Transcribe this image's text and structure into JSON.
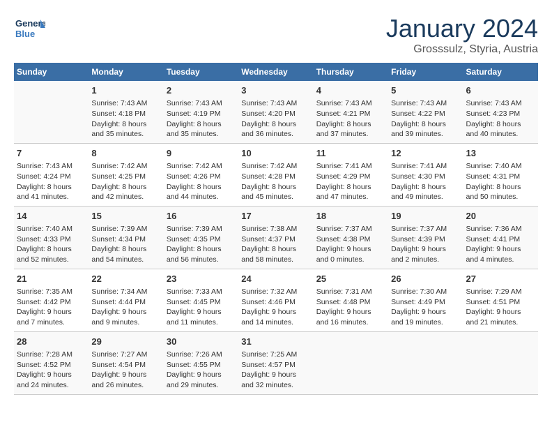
{
  "header": {
    "logo_general": "General",
    "logo_blue": "Blue",
    "month_year": "January 2024",
    "location": "Grosssulz, Styria, Austria"
  },
  "weekdays": [
    "Sunday",
    "Monday",
    "Tuesday",
    "Wednesday",
    "Thursday",
    "Friday",
    "Saturday"
  ],
  "weeks": [
    [
      {
        "day": "",
        "info": ""
      },
      {
        "day": "1",
        "info": "Sunrise: 7:43 AM\nSunset: 4:18 PM\nDaylight: 8 hours\nand 35 minutes."
      },
      {
        "day": "2",
        "info": "Sunrise: 7:43 AM\nSunset: 4:19 PM\nDaylight: 8 hours\nand 35 minutes."
      },
      {
        "day": "3",
        "info": "Sunrise: 7:43 AM\nSunset: 4:20 PM\nDaylight: 8 hours\nand 36 minutes."
      },
      {
        "day": "4",
        "info": "Sunrise: 7:43 AM\nSunset: 4:21 PM\nDaylight: 8 hours\nand 37 minutes."
      },
      {
        "day": "5",
        "info": "Sunrise: 7:43 AM\nSunset: 4:22 PM\nDaylight: 8 hours\nand 39 minutes."
      },
      {
        "day": "6",
        "info": "Sunrise: 7:43 AM\nSunset: 4:23 PM\nDaylight: 8 hours\nand 40 minutes."
      }
    ],
    [
      {
        "day": "7",
        "info": "Sunrise: 7:43 AM\nSunset: 4:24 PM\nDaylight: 8 hours\nand 41 minutes."
      },
      {
        "day": "8",
        "info": "Sunrise: 7:42 AM\nSunset: 4:25 PM\nDaylight: 8 hours\nand 42 minutes."
      },
      {
        "day": "9",
        "info": "Sunrise: 7:42 AM\nSunset: 4:26 PM\nDaylight: 8 hours\nand 44 minutes."
      },
      {
        "day": "10",
        "info": "Sunrise: 7:42 AM\nSunset: 4:28 PM\nDaylight: 8 hours\nand 45 minutes."
      },
      {
        "day": "11",
        "info": "Sunrise: 7:41 AM\nSunset: 4:29 PM\nDaylight: 8 hours\nand 47 minutes."
      },
      {
        "day": "12",
        "info": "Sunrise: 7:41 AM\nSunset: 4:30 PM\nDaylight: 8 hours\nand 49 minutes."
      },
      {
        "day": "13",
        "info": "Sunrise: 7:40 AM\nSunset: 4:31 PM\nDaylight: 8 hours\nand 50 minutes."
      }
    ],
    [
      {
        "day": "14",
        "info": "Sunrise: 7:40 AM\nSunset: 4:33 PM\nDaylight: 8 hours\nand 52 minutes."
      },
      {
        "day": "15",
        "info": "Sunrise: 7:39 AM\nSunset: 4:34 PM\nDaylight: 8 hours\nand 54 minutes."
      },
      {
        "day": "16",
        "info": "Sunrise: 7:39 AM\nSunset: 4:35 PM\nDaylight: 8 hours\nand 56 minutes."
      },
      {
        "day": "17",
        "info": "Sunrise: 7:38 AM\nSunset: 4:37 PM\nDaylight: 8 hours\nand 58 minutes."
      },
      {
        "day": "18",
        "info": "Sunrise: 7:37 AM\nSunset: 4:38 PM\nDaylight: 9 hours\nand 0 minutes."
      },
      {
        "day": "19",
        "info": "Sunrise: 7:37 AM\nSunset: 4:39 PM\nDaylight: 9 hours\nand 2 minutes."
      },
      {
        "day": "20",
        "info": "Sunrise: 7:36 AM\nSunset: 4:41 PM\nDaylight: 9 hours\nand 4 minutes."
      }
    ],
    [
      {
        "day": "21",
        "info": "Sunrise: 7:35 AM\nSunset: 4:42 PM\nDaylight: 9 hours\nand 7 minutes."
      },
      {
        "day": "22",
        "info": "Sunrise: 7:34 AM\nSunset: 4:44 PM\nDaylight: 9 hours\nand 9 minutes."
      },
      {
        "day": "23",
        "info": "Sunrise: 7:33 AM\nSunset: 4:45 PM\nDaylight: 9 hours\nand 11 minutes."
      },
      {
        "day": "24",
        "info": "Sunrise: 7:32 AM\nSunset: 4:46 PM\nDaylight: 9 hours\nand 14 minutes."
      },
      {
        "day": "25",
        "info": "Sunrise: 7:31 AM\nSunset: 4:48 PM\nDaylight: 9 hours\nand 16 minutes."
      },
      {
        "day": "26",
        "info": "Sunrise: 7:30 AM\nSunset: 4:49 PM\nDaylight: 9 hours\nand 19 minutes."
      },
      {
        "day": "27",
        "info": "Sunrise: 7:29 AM\nSunset: 4:51 PM\nDaylight: 9 hours\nand 21 minutes."
      }
    ],
    [
      {
        "day": "28",
        "info": "Sunrise: 7:28 AM\nSunset: 4:52 PM\nDaylight: 9 hours\nand 24 minutes."
      },
      {
        "day": "29",
        "info": "Sunrise: 7:27 AM\nSunset: 4:54 PM\nDaylight: 9 hours\nand 26 minutes."
      },
      {
        "day": "30",
        "info": "Sunrise: 7:26 AM\nSunset: 4:55 PM\nDaylight: 9 hours\nand 29 minutes."
      },
      {
        "day": "31",
        "info": "Sunrise: 7:25 AM\nSunset: 4:57 PM\nDaylight: 9 hours\nand 32 minutes."
      },
      {
        "day": "",
        "info": ""
      },
      {
        "day": "",
        "info": ""
      },
      {
        "day": "",
        "info": ""
      }
    ]
  ]
}
